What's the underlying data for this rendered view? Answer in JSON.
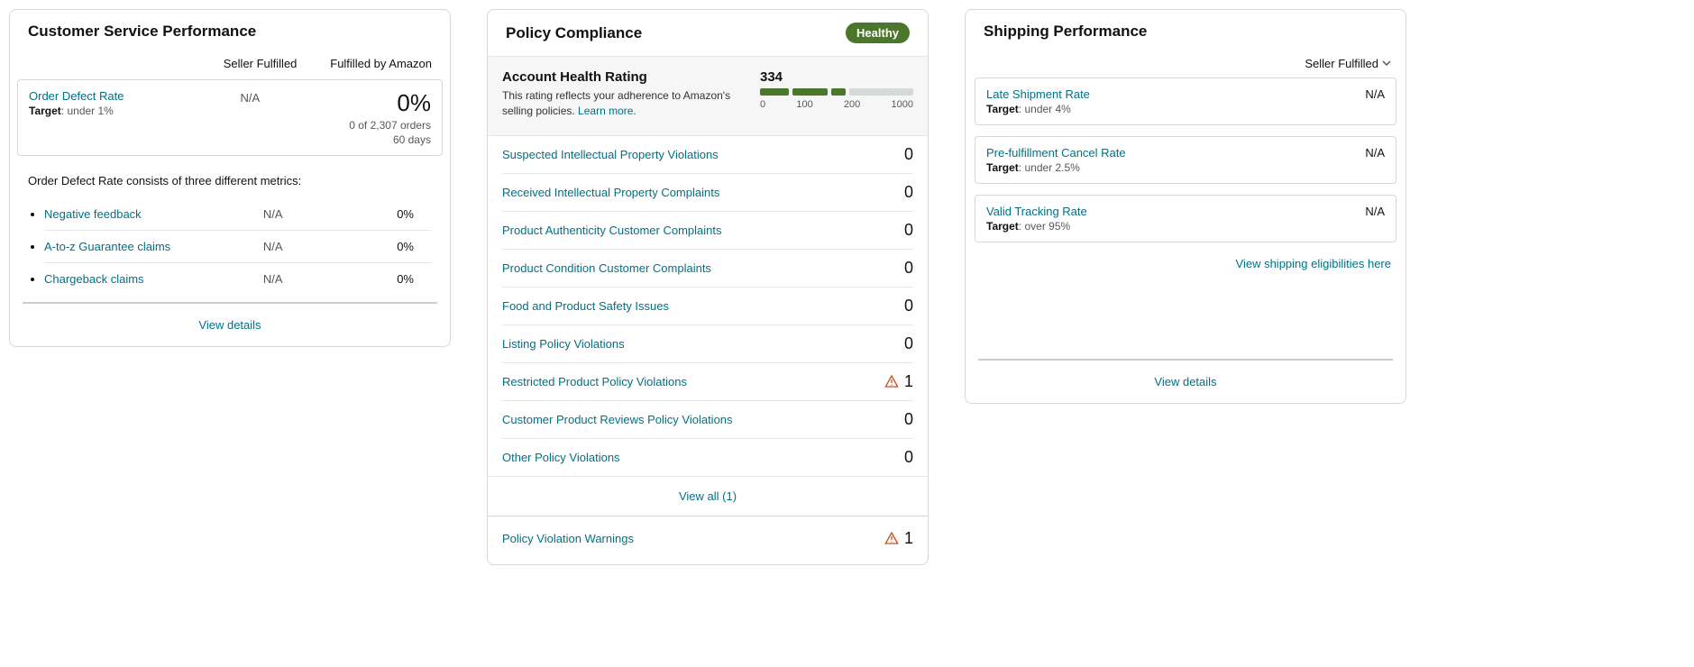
{
  "csp": {
    "title": "Customer Service Performance",
    "col_seller": "Seller Fulfilled",
    "col_fba": "Fulfilled by Amazon",
    "odr": {
      "label": "Order Defect Rate",
      "target": "under 1%",
      "seller_val": "N/A",
      "fba_pct": "0%",
      "fba_sub1": "0 of 2,307 orders",
      "fba_sub2": "60 days"
    },
    "odr_desc": "Order Defect Rate consists of three different metrics:",
    "metrics": [
      {
        "label": "Negative feedback",
        "seller": "N/A",
        "fba": "0%"
      },
      {
        "label": "A-to-z Guarantee claims",
        "seller": "N/A",
        "fba": "0%"
      },
      {
        "label": "Chargeback claims",
        "seller": "N/A",
        "fba": "0%"
      }
    ],
    "footer": "View details"
  },
  "pc": {
    "title": "Policy Compliance",
    "badge": "Healthy",
    "ahr": {
      "title": "Account Health Rating",
      "desc": "This rating reflects your adherence to Amazon's selling policies. ",
      "learn": "Learn more.",
      "score": "334",
      "ticks": [
        "0",
        "100",
        "200",
        "1000"
      ]
    },
    "rows": [
      {
        "label": "Suspected Intellectual Property Violations",
        "count": "0",
        "warn": false
      },
      {
        "label": "Received Intellectual Property Complaints",
        "count": "0",
        "warn": false
      },
      {
        "label": "Product Authenticity Customer Complaints",
        "count": "0",
        "warn": false
      },
      {
        "label": "Product Condition Customer Complaints",
        "count": "0",
        "warn": false
      },
      {
        "label": "Food and Product Safety Issues",
        "count": "0",
        "warn": false
      },
      {
        "label": "Listing Policy Violations",
        "count": "0",
        "warn": false
      },
      {
        "label": "Restricted Product Policy Violations",
        "count": "1",
        "warn": true
      },
      {
        "label": "Customer Product Reviews Policy Violations",
        "count": "0",
        "warn": false
      },
      {
        "label": "Other Policy Violations",
        "count": "0",
        "warn": false
      }
    ],
    "view_all": "View all (1)",
    "warn_row": {
      "label": "Policy Violation Warnings",
      "count": "1"
    }
  },
  "sp": {
    "title": "Shipping Performance",
    "filter": "Seller Fulfilled",
    "metrics": [
      {
        "label": "Late Shipment Rate",
        "target": "under 4%",
        "val": "N/A"
      },
      {
        "label": "Pre-fulfillment Cancel Rate",
        "target": "under 2.5%",
        "val": "N/A"
      },
      {
        "label": "Valid Tracking Rate",
        "target": "over 95%",
        "val": "N/A"
      }
    ],
    "elig_link": "View shipping eligibilities here",
    "footer": "View details"
  },
  "target_word": "Target"
}
